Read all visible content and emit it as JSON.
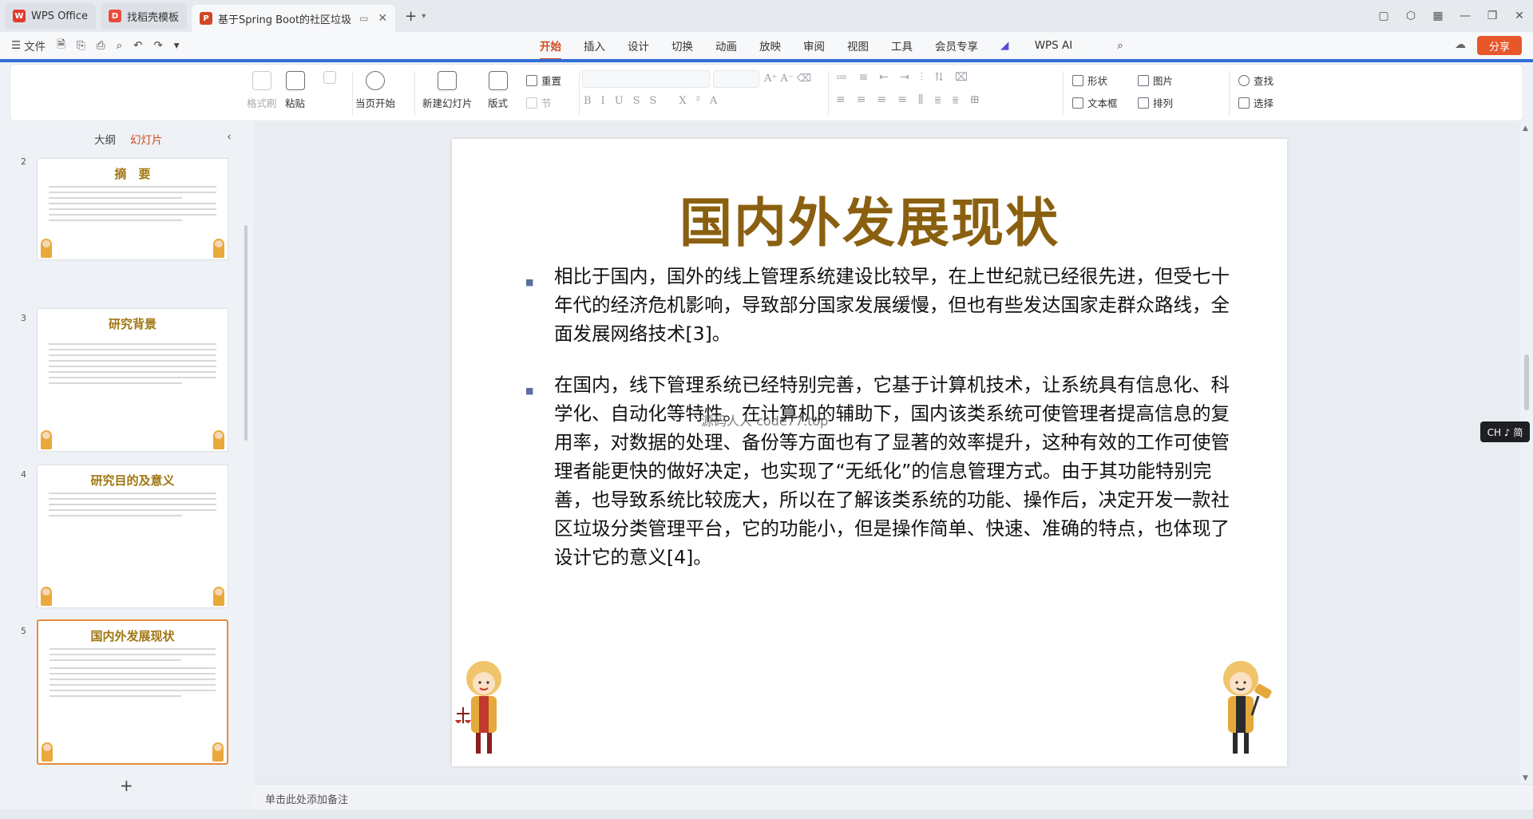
{
  "tabs": [
    {
      "label": "WPS Office",
      "icon": "wps-icon",
      "color": "#e23b2e"
    },
    {
      "label": "找稻壳模板",
      "icon": "docer-icon",
      "color": "#e84b3c"
    },
    {
      "label": "基于Spring Boot的社区垃圾",
      "icon": "ppt-icon",
      "color": "#d24726"
    }
  ],
  "menubar": {
    "file": "文件",
    "tabs": [
      "开始",
      "插入",
      "设计",
      "切换",
      "动画",
      "放映",
      "审阅",
      "视图",
      "工具",
      "会员专享"
    ],
    "active_tab": "开始",
    "ai": "WPS AI",
    "share": "分享"
  },
  "ribbon": {
    "format_painter": "格式刷",
    "paste": "粘贴",
    "from_current": "当页开始",
    "new_slide": "新建幻灯片",
    "layout": "版式",
    "reset": "重置",
    "section": "节",
    "shape": "形状",
    "picture": "图片",
    "textbox": "文本框",
    "arrange": "排列",
    "find": "查找",
    "select": "选择"
  },
  "panel": {
    "outline": "大纲",
    "slides": "幻灯片",
    "active": "幻灯片"
  },
  "thumbs": [
    {
      "num": "2",
      "title": "摘　要"
    },
    {
      "num": "3",
      "title": "研究背景"
    },
    {
      "num": "4",
      "title": "研究目的及意义"
    },
    {
      "num": "5",
      "title": "国内外发展现状"
    }
  ],
  "slide": {
    "title": "国内外发展现状",
    "paragraphs": [
      "相比于国内，国外的线上管理系统建设比较早，在上世纪就已经很先进，但受七十年代的经济危机影响，导致部分国家发展缓慢，但也有些发达国家走群众路线，全面发展网络技术[3]。",
      "在国内，线下管理系统已经特别完善，它基于计算机技术，让系统具有信息化、科学化、自动化等特性。在计算机的辅助下，国内该类系统可使管理者提高信息的复用率，对数据的处理、备份等方面也有了显著的效率提升，这种有效的工作可使管理者能更快的做好决定，也实现了“无纸化”的信息管理方式。由于其功能特别完善，也导致系统比较庞大，所以在了解该类系统的功能、操作后，决定开发一款社区垃圾分类管理平台，它的功能小，但是操作简单、快速、准确的特点，也体现了设计它的意义[4]。"
    ],
    "watermark": "源码人人 code77.top"
  },
  "ime_badge": "CH ♪ 简",
  "notes_placeholder": "单击此处添加备注"
}
